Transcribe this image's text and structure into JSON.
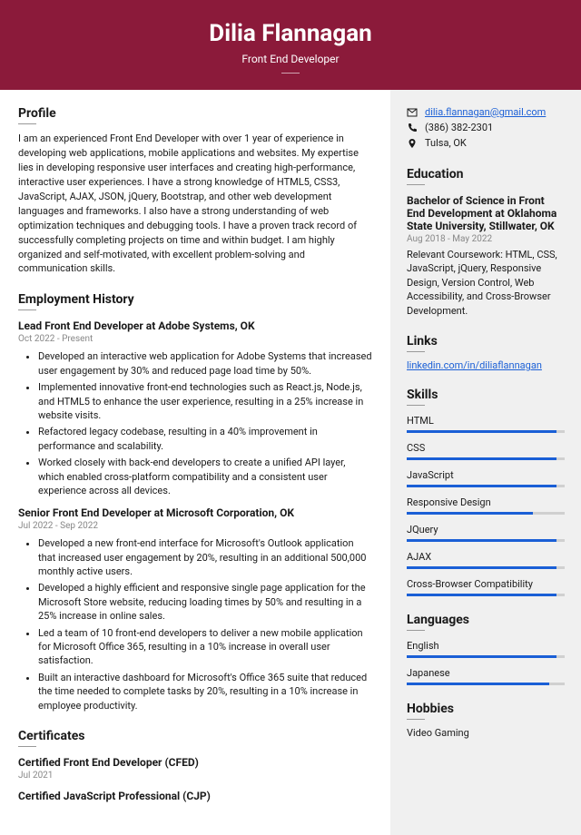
{
  "header": {
    "name": "Dilia Flannagan",
    "title": "Front End Developer"
  },
  "profile": {
    "heading": "Profile",
    "text": "I am an experienced Front End Developer with over 1 year of experience in developing web applications, mobile applications and websites. My expertise lies in developing responsive user interfaces and creating high-performance, interactive user experiences. I have a strong knowledge of HTML5, CSS3, JavaScript, AJAX, JSON, jQuery, Bootstrap, and other web development languages and frameworks. I also have a strong understanding of web optimization techniques and debugging tools. I have a proven track record of successfully completing projects on time and within budget. I am highly organized and self-motivated, with excellent problem-solving and communication skills."
  },
  "employment": {
    "heading": "Employment History",
    "jobs": [
      {
        "title": "Lead Front End Developer at Adobe Systems, OK",
        "dates": "Oct 2022 - Present",
        "bullets": [
          "Developed an interactive web application for Adobe Systems that increased user engagement by 30% and reduced page load time by 50%.",
          "Implemented innovative front-end technologies such as React.js, Node.js, and HTML5 to enhance the user experience, resulting in a 25% increase in website visits.",
          "Refactored legacy codebase, resulting in a 40% improvement in performance and scalability.",
          "Worked closely with back-end developers to create a unified API layer, which enabled cross-platform compatibility and a consistent user experience across all devices."
        ]
      },
      {
        "title": "Senior Front End Developer at Microsoft Corporation, OK",
        "dates": "Jul 2022 - Sep 2022",
        "bullets": [
          "Developed a new front-end interface for Microsoft's Outlook application that increased user engagement by 20%, resulting in an additional 500,000 monthly active users.",
          "Developed a highly efficient and responsive single page application for the Microsoft Store website, reducing loading times by 50% and resulting in a 25% increase in online sales.",
          "Led a team of 10 front-end developers to deliver a new mobile application for Microsoft Office 365, resulting in a 10% increase in overall user satisfaction.",
          "Built an interactive dashboard for Microsoft's Office 365 suite that reduced the time needed to complete tasks by 20%, resulting in a 10% increase in employee productivity."
        ]
      }
    ]
  },
  "certs": {
    "heading": "Certificates",
    "items": [
      {
        "title": "Certified Front End Developer (CFED)",
        "date": "Jul 2021"
      },
      {
        "title": "Certified JavaScript Professional (CJP)"
      }
    ]
  },
  "contact": {
    "email": "dilia.flannagan@gmail.com",
    "phone": "(386) 382-2301",
    "location": "Tulsa, OK"
  },
  "education": {
    "heading": "Education",
    "degree": "Bachelor of Science in Front End Development at Oklahoma State University, Stillwater, OK",
    "dates": "Aug 2018 - May 2022",
    "desc": "Relevant Coursework: HTML, CSS, JavaScript, jQuery, Responsive Design, Version Control, Web Accessibility, and Cross-Browser Development."
  },
  "links": {
    "heading": "Links",
    "url": "linkedin.com/in/diliaflannagan"
  },
  "skills": {
    "heading": "Skills",
    "items": [
      {
        "name": "HTML",
        "pct": 95
      },
      {
        "name": "CSS",
        "pct": 95
      },
      {
        "name": "JavaScript",
        "pct": 95
      },
      {
        "name": "Responsive Design",
        "pct": 80
      },
      {
        "name": "JQuery",
        "pct": 95
      },
      {
        "name": "AJAX",
        "pct": 95
      },
      {
        "name": "Cross-Browser Compatibility",
        "pct": 95
      }
    ]
  },
  "languages": {
    "heading": "Languages",
    "items": [
      {
        "name": "English",
        "pct": 95
      },
      {
        "name": "Japanese",
        "pct": 90
      }
    ]
  },
  "hobbies": {
    "heading": "Hobbies",
    "items": [
      "Video Gaming"
    ]
  }
}
